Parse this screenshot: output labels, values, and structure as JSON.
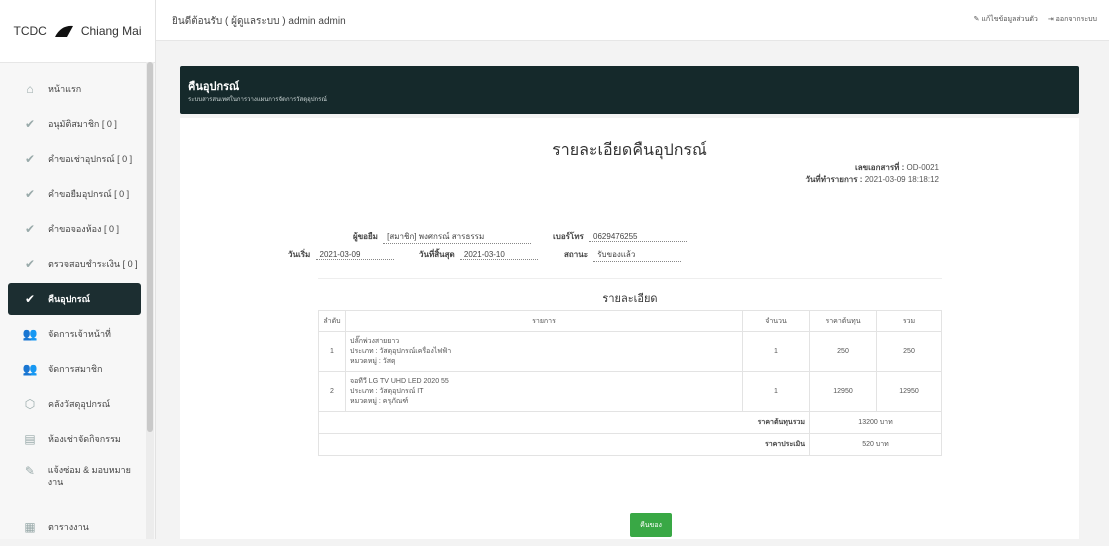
{
  "sidebar": {
    "logo_text": "TCDC",
    "logo_city": "Chiang Mai",
    "items": [
      {
        "label": "หน้าแรก",
        "icon": "home-icon",
        "glyph": "⌂"
      },
      {
        "label": "อนุมัติสมาชิก [ 0 ]",
        "icon": "check-icon",
        "glyph": "✔"
      },
      {
        "label": "คำขอเช่าอุปกรณ์ [ 0 ]",
        "icon": "check-icon",
        "glyph": "✔"
      },
      {
        "label": "คำขอยืมอุปกรณ์ [ 0 ]",
        "icon": "check-icon",
        "glyph": "✔"
      },
      {
        "label": "คำขอจองห้อง [ 0 ]",
        "icon": "check-icon",
        "glyph": "✔"
      },
      {
        "label": "ตรวจสอบชำระเงิน [ 0 ]",
        "icon": "check-icon",
        "glyph": "✔"
      },
      {
        "label": "คืนอุปกรณ์",
        "icon": "check-icon",
        "glyph": "✔"
      },
      {
        "label": "จัดการเจ้าหน้าที่",
        "icon": "users-icon",
        "glyph": "👥"
      },
      {
        "label": "จัดการสมาชิก",
        "icon": "users-icon",
        "glyph": "👥"
      },
      {
        "label": "คลังวัสดุอุปกรณ์",
        "icon": "cubes-icon",
        "glyph": "⬡"
      },
      {
        "label": "ห้องเช่าจัดกิจกรรม",
        "icon": "room-icon",
        "glyph": "▤"
      },
      {
        "label": "แจ้งซ่อม & มอบหมายงาน",
        "icon": "wrench-icon",
        "glyph": "✎"
      },
      {
        "label": "ตารางงาน",
        "icon": "calendar-icon",
        "glyph": "▦"
      }
    ]
  },
  "topbar": {
    "welcome": "ยินดีต้อนรับ ( ผู้ดูแลระบบ ) admin admin",
    "edit_profile": "แก้ไขข้อมูลส่วนตัว",
    "logout": "ออกจากระบบ"
  },
  "banner": {
    "title": "คืนอุปกรณ์",
    "subtitle": "ระบบสารสนเทศในการวางแผนการจัดการวัสดุอุปกรณ์"
  },
  "doc": {
    "title": "รายละเอียดคืนอุปกรณ์",
    "doc_no_label": "เลขเอกสารที่ :",
    "doc_no": "OD-0021",
    "date_label": "วันที่ทำรายการ :",
    "date": "2021-03-09 18:18:12",
    "requester_label": "ผู้ขอยืม",
    "requester": "[สมาชิก] พงศกรณ์ สารธรรม",
    "phone_label": "เบอร์โทร",
    "phone": "0629476255",
    "start_label": "วันเริ่ม",
    "start": "2021-03-09",
    "end_label": "วันที่สิ้นสุด",
    "end": "2021-03-10",
    "status_label": "สถานะ",
    "status": "รับของแล้ว",
    "section": "รายละเอียด"
  },
  "table": {
    "headers": [
      "ลำดับ",
      "รายการ",
      "จำนวน",
      "ราคาต้นทุน",
      "รวม"
    ],
    "rows": [
      {
        "no": "1",
        "name": "ปลั๊กพ่วงสายยาว",
        "type": "ประเภท : วัสดุอุปกรณ์เครื่องไฟฟ้า",
        "group": "หมวดหมู่ : วัสดุ",
        "qty": "1",
        "cost": "250",
        "total": "250"
      },
      {
        "no": "2",
        "name": "จอทีวี LG TV UHD LED 2020 55",
        "type": "ประเภท : วัสดุอุปกรณ์ IT",
        "group": "หมวดหมู่ : ครุภัณฑ์",
        "qty": "1",
        "cost": "12950",
        "total": "12950"
      }
    ],
    "sum_cost_label": "ราคาต้นทุนรวม",
    "sum_cost": "13200 บาท",
    "assess_label": "ราคาประเมิน",
    "assess": "520 บาท"
  },
  "actions": {
    "return_label": "คืนของ"
  },
  "colors": {
    "banner": "#15292b",
    "active_nav": "#1c2e31",
    "button": "#39a845"
  }
}
